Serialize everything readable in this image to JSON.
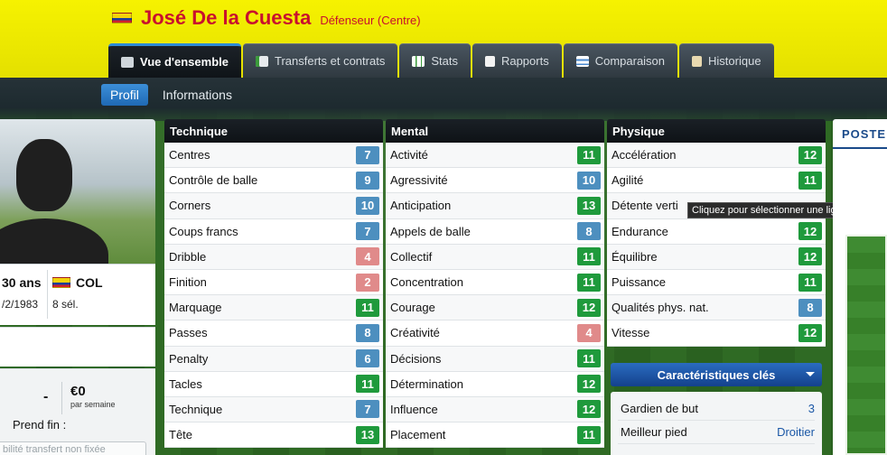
{
  "header": {
    "player_name": "José De la Cuesta",
    "role": "Défenseur (Centre)",
    "flag_icon": "colombia-flag-icon"
  },
  "tabs": [
    {
      "label": "Vue d'ensemble",
      "icon": "overview-icon",
      "active": true
    },
    {
      "label": "Transferts et contrats",
      "icon": "transfer-icon"
    },
    {
      "label": "Stats",
      "icon": "stats-icon"
    },
    {
      "label": "Rapports",
      "icon": "report-icon"
    },
    {
      "label": "Comparaison",
      "icon": "compare-icon"
    },
    {
      "label": "Historique",
      "icon": "history-icon"
    }
  ],
  "subnav": {
    "profil": "Profil",
    "informations": "Informations"
  },
  "profile": {
    "age": "30 ans",
    "nationality": "COL",
    "dob": "/2/1983",
    "caps": "8 sél."
  },
  "contract": {
    "dash": "-",
    "amount": "€0",
    "per_week": "par semaine",
    "ends": "Prend fin :",
    "transfer_field": "bilité transfert non fixée"
  },
  "panels": {
    "technique": {
      "title": "Technique",
      "rows": [
        {
          "name": "Centres",
          "value": "7",
          "color": "blue"
        },
        {
          "name": "Contrôle de balle",
          "value": "9",
          "color": "blue"
        },
        {
          "name": "Corners",
          "value": "10",
          "color": "blue"
        },
        {
          "name": "Coups francs",
          "value": "7",
          "color": "blue"
        },
        {
          "name": "Dribble",
          "value": "4",
          "color": "red"
        },
        {
          "name": "Finition",
          "value": "2",
          "color": "red"
        },
        {
          "name": "Marquage",
          "value": "11",
          "color": "green"
        },
        {
          "name": "Passes",
          "value": "8",
          "color": "blue"
        },
        {
          "name": "Penalty",
          "value": "6",
          "color": "blue"
        },
        {
          "name": "Tacles",
          "value": "11",
          "color": "green"
        },
        {
          "name": "Technique",
          "value": "7",
          "color": "blue"
        },
        {
          "name": "Tête",
          "value": "13",
          "color": "green"
        }
      ]
    },
    "mental": {
      "title": "Mental",
      "rows": [
        {
          "name": "Activité",
          "value": "11",
          "color": "green"
        },
        {
          "name": "Agressivité",
          "value": "10",
          "color": "blue"
        },
        {
          "name": "Anticipation",
          "value": "13",
          "color": "green"
        },
        {
          "name": "Appels de balle",
          "value": "8",
          "color": "blue"
        },
        {
          "name": "Collectif",
          "value": "11",
          "color": "green"
        },
        {
          "name": "Concentration",
          "value": "11",
          "color": "green"
        },
        {
          "name": "Courage",
          "value": "12",
          "color": "green"
        },
        {
          "name": "Créativité",
          "value": "4",
          "color": "red"
        },
        {
          "name": "Décisions",
          "value": "11",
          "color": "green"
        },
        {
          "name": "Détermination",
          "value": "12",
          "color": "green"
        },
        {
          "name": "Influence",
          "value": "12",
          "color": "green"
        },
        {
          "name": "Placement",
          "value": "11",
          "color": "green"
        }
      ]
    },
    "physique": {
      "title": "Physique",
      "rows": [
        {
          "name": "Accélération",
          "value": "12",
          "color": "green"
        },
        {
          "name": "Agilité",
          "value": "11",
          "color": "green"
        },
        {
          "name": "Détente verti",
          "value": "",
          "color": "green"
        },
        {
          "name": "Endurance",
          "value": "12",
          "color": "green"
        },
        {
          "name": "Équilibre",
          "value": "12",
          "color": "green"
        },
        {
          "name": "Puissance",
          "value": "11",
          "color": "green"
        },
        {
          "name": "Qualités phys. nat.",
          "value": "8",
          "color": "blue"
        },
        {
          "name": "Vitesse",
          "value": "12",
          "color": "green"
        }
      ]
    }
  },
  "tooltip": "Cliquez pour sélectionner une ligne",
  "key_characteristics": {
    "button": "Caractéristiques clés",
    "rows": [
      {
        "name": "Gardien de but",
        "value": "3"
      },
      {
        "name": "Meilleur pied",
        "value": "Droitier"
      }
    ]
  },
  "poste": {
    "title": "POSTE"
  }
}
